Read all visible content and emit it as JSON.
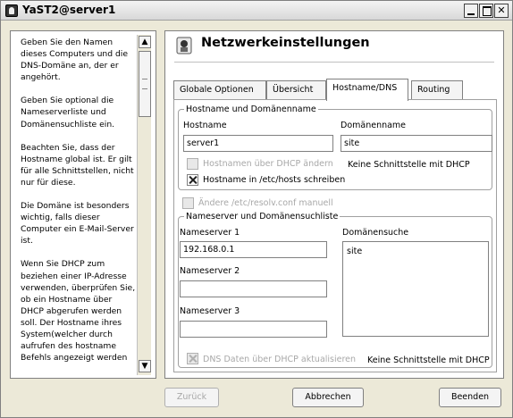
{
  "window": {
    "title": "YaST2@server1"
  },
  "help": {
    "paragraphs": [
      "Geben Sie den Namen dieses Computers und die DNS-Domäne an, der er angehört.",
      "Geben Sie optional die Nameserverliste und Domänensuchliste ein.",
      "Beachten Sie, dass der Hostname global ist. Er gilt für alle Schnittstellen, nicht nur für diese.",
      "Die Domäne ist besonders wichtig, falls dieser Computer ein E-Mail-Server ist.",
      "Wenn Sie DHCP zum beziehen einer IP-Adresse verwenden, überprüfen Sie, ob ein Hostname über DHCP abgerufen werden soll. Der Hostname ihres System(welcher durch aufrufen des hostname Befehls angezeigt werden"
    ]
  },
  "main": {
    "title": "Netzwerkeinstellungen",
    "tabs": [
      "Globale Optionen",
      "Übersicht",
      "Hostname/DNS",
      "Routing"
    ],
    "active_tab": "Hostname/DNS"
  },
  "host_group": {
    "title": "Hostname und Domänenname",
    "hostname_label": "Hostname",
    "hostname_value": "server1",
    "domain_label": "Domänenname",
    "domain_value": "site",
    "dhcp_hostname_label": "Hostnamen über DHCP ändern",
    "dhcp_status": "Keine Schnittstelle mit DHCP",
    "etc_hosts_label": "Hostname in /etc/hosts schreiben"
  },
  "resolv_label": "Ändere /etc/resolv.conf manuell",
  "ns_group": {
    "title": "Nameserver und Domänensuchliste",
    "ns1_label": "Nameserver 1",
    "ns1_value": "192.168.0.1",
    "ns2_label": "Nameserver 2",
    "ns2_value": "",
    "ns3_label": "Nameserver 3",
    "ns3_value": "",
    "search_label": "Domänensuche",
    "search_items": [
      "site"
    ],
    "dhcp_dns_label": "DNS Daten über DHCP aktualisieren",
    "dhcp_status": "Keine Schnittstelle mit DHCP"
  },
  "buttons": {
    "back": "Zurück",
    "cancel": "Abbrechen",
    "finish": "Beenden"
  }
}
